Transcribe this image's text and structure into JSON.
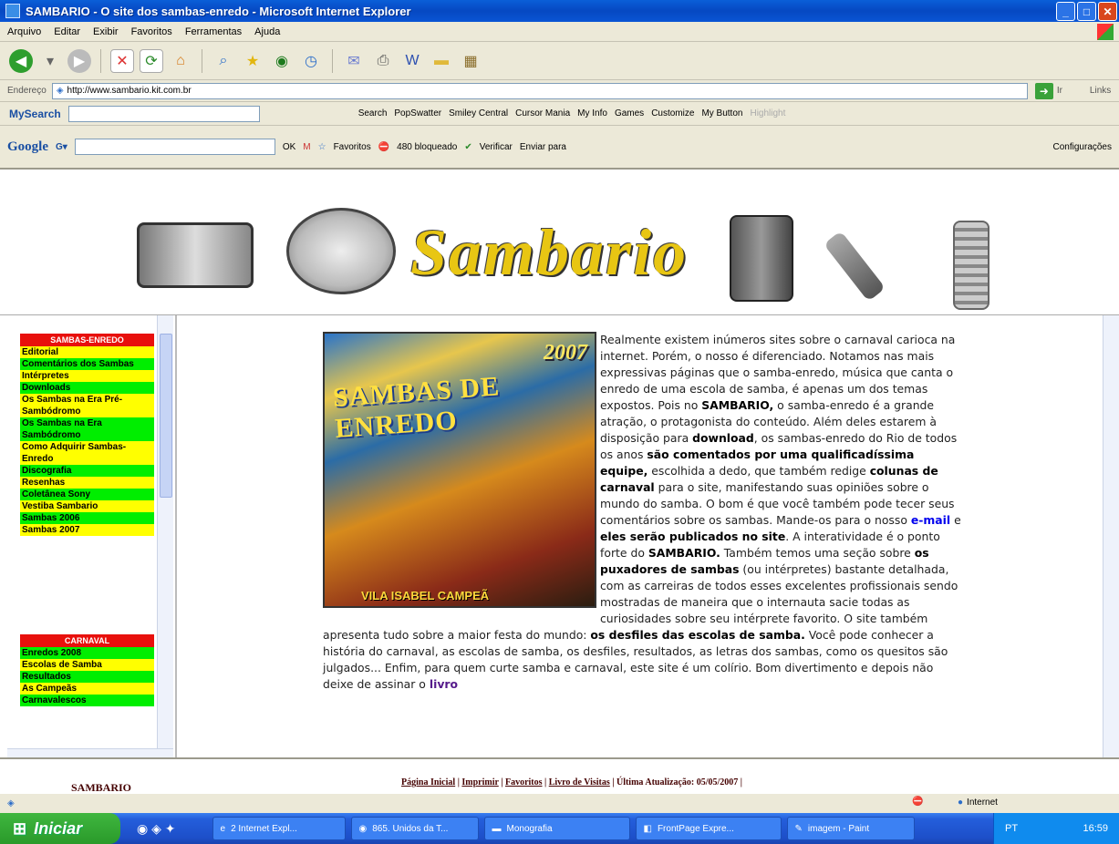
{
  "window": {
    "title": "SAMBARIO - O site dos sambas-enredo - Microsoft Internet Explorer"
  },
  "menubar": {
    "items": [
      "Arquivo",
      "Editar",
      "Exibir",
      "Favoritos",
      "Ferramentas",
      "Ajuda"
    ]
  },
  "address": {
    "label": "Endereço",
    "url": "http://www.sambario.kit.com.br",
    "go_label": "Ir",
    "links_label": "Links"
  },
  "searchbar": {
    "brand": "MySearch",
    "search_label": "Search",
    "items": [
      "PopSwatter",
      "Smiley Central",
      "Cursor Mania",
      "My Info",
      "Games",
      "Customize",
      "My Button",
      "Highlight"
    ]
  },
  "googlebar": {
    "brand": "Google",
    "ok_label": "OK",
    "favoritos": "Favoritos",
    "blocked": "480 bloqueado",
    "verificar": "Verificar",
    "enviar": "Enviar para",
    "config": "Configurações"
  },
  "banner": {
    "logo": "Sambario"
  },
  "sidebar": {
    "section1_head": "SAMBAS-ENREDO",
    "section1_items": [
      "Editorial",
      "Comentários dos Sambas",
      "Intérpretes",
      "Downloads",
      "Os Sambas na Era Pré-Sambódromo",
      "Os Sambas na Era Sambódromo",
      "Como Adquirir Sambas-Enredo",
      "Discografia",
      "Resenhas",
      "Coletânea Sony",
      "Vestiba Sambario",
      "Sambas 2006",
      "Sambas 2007"
    ],
    "section2_head": "CARNAVAL",
    "section2_items": [
      "Enredos 2008",
      "Escolas de Samba",
      "Resultados",
      "As Campeãs",
      "Carnavalescos"
    ]
  },
  "poster": {
    "year": "2007",
    "title": "SAMBAS DE ENREDO",
    "footer": "VILA ISABEL CAMPEÃ"
  },
  "main": {
    "p1": "Realmente existem inúmeros sites sobre o carnaval carioca na internet. Porém, o nosso é diferenciado. Notamos nas mais expressivas páginas que o samba-enredo, música que canta o enredo de uma escola de samba, é apenas um dos temas expostos. Pois no ",
    "b1": "SAMBARIO,",
    "p2": " o samba-enredo é a grande atração, o protagonista do conteúdo. Além deles estarem à disposição para ",
    "b2": "download",
    "p3": ", os sambas-enredo do Rio de todos os anos ",
    "b3": "são comentados por uma qualificadíssima equipe,",
    "p4": " escolhida a dedo, que também redige ",
    "b4": "colunas de carnaval",
    "p5": " para o site, manifestando suas opiniões sobre o mundo do samba. O bom é que você também pode tecer seus comentários sobre os sambas. Mande-os para o nosso ",
    "link_email": "e-mail",
    "p6": " e ",
    "b5": "eles serão publicados no site",
    "p7": ". A interatividade é o ponto forte do ",
    "b6": "SAMBARIO.",
    "p8": " Também temos uma seção sobre ",
    "b7": "os puxadores de sambas",
    "p9": " (ou intérpretes) bastante detalhada, com as carreiras de todos esses excelentes profissionais sendo mostradas de maneira que o internauta sacie todas as curiosidades sobre seu intérprete favorito. O site também apresenta tudo sobre a maior festa do mundo: ",
    "b8": "os desfiles das escolas de samba.",
    "p10": " Você pode conhecer a história do carnaval, as escolas de samba, os desfiles, resultados, as letras dos sambas, como os quesitos são julgados... Enfim, para quem curte samba e carnaval, este site é um colírio. Bom divertimento e depois não deixe de assinar o ",
    "link_livro": "livro"
  },
  "footer": {
    "brand": "SAMBARIO",
    "links": [
      "Página Inicial",
      "Imprimir",
      "Favoritos",
      "Livro de Visitas"
    ],
    "updated": "Última Atualização: 05/05/2007"
  },
  "status": {
    "zone": "Internet"
  },
  "taskbar": {
    "start": "Iniciar",
    "tasks": [
      "2 Internet Expl...",
      "865. Unidos da T...",
      "Monografia",
      "FrontPage Expre...",
      "imagem - Paint"
    ],
    "lang": "PT",
    "time": "16:59"
  }
}
